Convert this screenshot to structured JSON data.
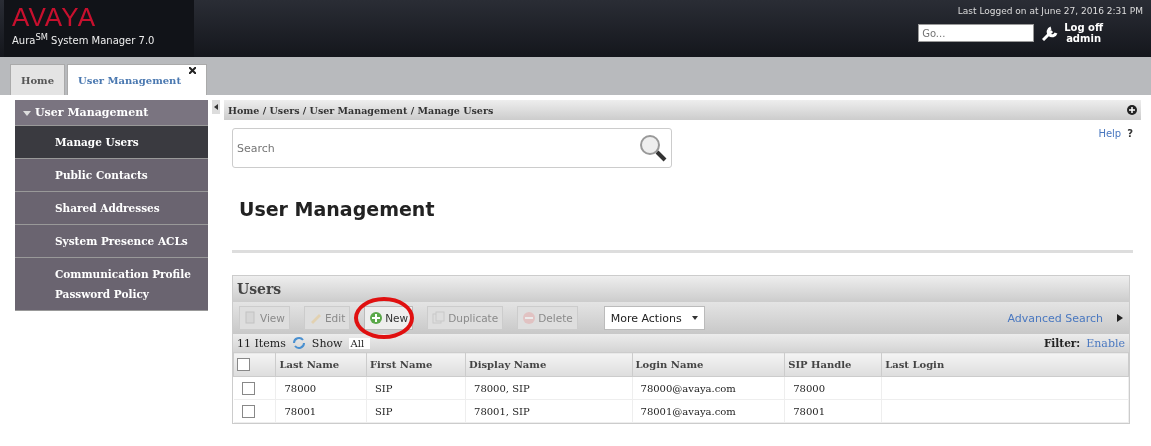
{
  "header": {
    "logo": "AVAYA",
    "product": "Aura$^{SM}$ System Manager 7.0",
    "last_logged": "Last Logged on at June 27, 2016 2:31 PM",
    "go_field": {
      "placeholder": "Go..."
    },
    "logoff": [
      "Log off",
      "admin"
    ]
  },
  "tabs": [
    {
      "label": "Home",
      "selected": false,
      "closable": false
    },
    {
      "label": "User Management",
      "selected": true,
      "closable": true
    }
  ],
  "sidebar": {
    "group": "User Management",
    "expanded": true,
    "items": [
      {
        "label": "Manage Users",
        "selected": true
      },
      {
        "label": "Public Contacts",
        "selected": false
      },
      {
        "label": "Shared Addresses",
        "selected": false
      },
      {
        "label": "System Presence ACLs",
        "selected": false
      },
      {
        "label": "Communication Profile Password Policy",
        "selected": false
      }
    ]
  },
  "breadcrumb": "Home / Users / User Management / Manage Users",
  "search": {
    "placeholder": "Search"
  },
  "help": "Help",
  "help_mark": "?",
  "heading": "User Management",
  "panel": {
    "title": "Users",
    "buttons": [
      {
        "label": "View",
        "kind": "view",
        "disabled": true,
        "highlighted": false
      },
      {
        "label": "Edit",
        "kind": "edit",
        "disabled": true,
        "highlighted": false
      },
      {
        "label": "New",
        "kind": "new",
        "disabled": false,
        "highlighted": true
      },
      {
        "label": "Duplicate",
        "kind": "duplicate",
        "disabled": true,
        "highlighted": false
      },
      {
        "label": "Delete",
        "kind": "delete",
        "disabled": true,
        "highlighted": false
      }
    ],
    "more_actions": "More Actions",
    "advanced_search": "Advanced Search",
    "count": "11 Items",
    "show_label": "Show",
    "show_value": "All",
    "filter_label": "Filter:",
    "filter_link": "Enable"
  },
  "table": {
    "all_checked": false,
    "columns": [
      "Last Name",
      "First Name",
      "Display Name",
      "Login Name",
      "SIP Handle",
      "Last Login"
    ],
    "rows": [
      {
        "checked": false,
        "cells": [
          "78000",
          "SIP",
          "78000, SIP",
          "78000@avaya.com",
          "78000",
          ""
        ]
      },
      {
        "checked": false,
        "cells": [
          "78001",
          "SIP",
          "78001, SIP",
          "78001@avaya.com",
          "78001",
          ""
        ]
      }
    ]
  }
}
